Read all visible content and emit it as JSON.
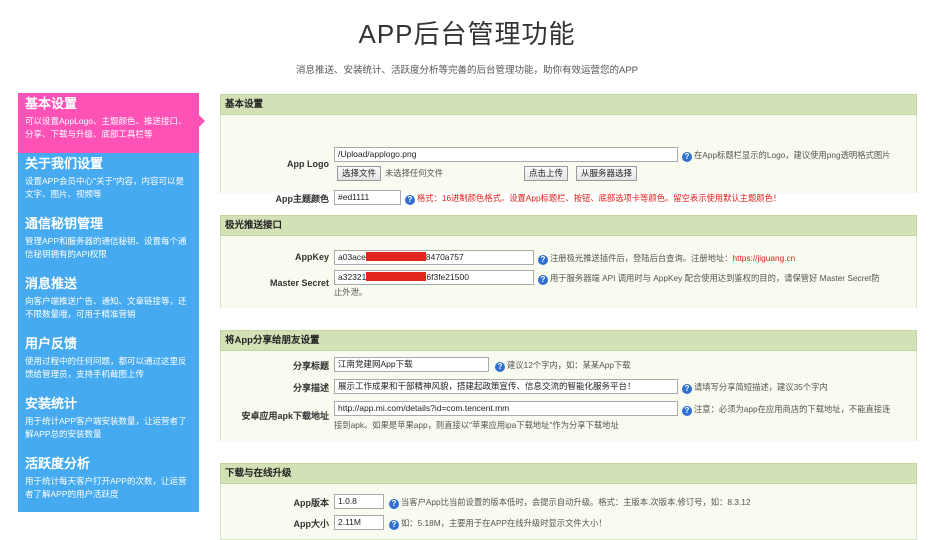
{
  "header": {
    "title": "APP后台管理功能",
    "subtitle": "消息推送、安装统计、活跃度分析等完善的后台管理功能，助你有效运营您的APP"
  },
  "sidebar": {
    "items": [
      {
        "title": "基本设置",
        "desc": "可以设置AppLogo、主题颜色、推送接口、分享、下载与升级、底部工具栏等",
        "active": true
      },
      {
        "title": "关于我们设置",
        "desc": "设置APP会员中心\"关于\"内容，内容可以是文字、图片、视频等"
      },
      {
        "title": "通信秘钥管理",
        "desc": "管理APP和服务器的通信秘钥、设置每个通信秘钥拥有的API权限"
      },
      {
        "title": "消息推送",
        "desc": "向客户端推送广告、通知、文章链接等，还不限数量哦，可用于精准营销"
      },
      {
        "title": "用户反馈",
        "desc": "使用过程中的任何问题，都可以通过这里反馈给管理员，支持手机截图上传"
      },
      {
        "title": "安装统计",
        "desc": "用于统计APP客户端安装数量，让运营者了解APP总的安装数量"
      },
      {
        "title": "活跃度分析",
        "desc": "用于统计每天客户打开APP的次数，让运营者了解APP的用户活跃度"
      }
    ]
  },
  "sections": {
    "basic": {
      "title": "基本设置",
      "logo_label": "App Logo",
      "logo_value": "/Upload/applogo.png",
      "choose_file": "选择文件",
      "no_file": "未选择任何文件",
      "upload": "点击上传",
      "from_server": "从服务器选择",
      "logo_hint": "在App标题栏显示的Logo，建议使用png透明格式图片",
      "color_label": "App主题颜色",
      "color_value": "#ed1111",
      "color_hint": "格式：16进制颜色格式。设置App标题栏、按钮、底部选项卡等颜色。留空表示使用默认主题颜色！"
    },
    "push": {
      "title": "极光推送接口",
      "appkey_label": "AppKey",
      "appkey_a": "a03ace",
      "appkey_b": "8470a757",
      "appkey_hint": "注册极光推送插件后，登陆后台查询。注册地址：",
      "appkey_link": "https://jiguang.cn",
      "secret_label": "Master Secret",
      "secret_a": "a32321",
      "secret_b": "6f3fe21500",
      "secret_hint1": "用于服务器端 API 调用时与 AppKey 配合使用达到鉴权的目的，请保管好 Master Secret防",
      "secret_hint2": "止外泄。"
    },
    "share": {
      "title": "将App分享给朋友设置",
      "title_label": "分享标题",
      "title_value": "江南党建网App下载",
      "title_hint": "建议12个字内，如：某某App下载",
      "desc_label": "分享描述",
      "desc_value": "展示工作成果和干部精神风貌，搭建起政策宣传、信息交流的智能化服务平台！",
      "desc_hint": "请填写分享简短描述，建议35个字内",
      "apk_label": "安卓应用apk下载地址",
      "apk_value": "http://app.mi.com/details?id=com.tencent.mm",
      "apk_hint1": "注意：必须为app在应用商店的下载地址，不能直接连",
      "apk_hint2": "接到apk。如果是苹果app，则直接以\"苹果应用ipa下载地址\"作为分享下载地址"
    },
    "upgrade": {
      "title": "下载与在线升级",
      "ver_label": "App版本",
      "ver_value": "1.0.8",
      "ver_hint": "当客户App比当前设置的版本低时，会提示自动升级。格式：主版本.次版本.修订号，如：8.3.12",
      "size_label": "App大小",
      "size_value": "2.11M",
      "size_hint": "如：5.18M，主要用于在APP在线升级时显示文件大小！"
    }
  },
  "colors": {
    "sidebar": "#45aaf0",
    "active": "#ff52b7",
    "section_head": "#d3e1b6",
    "accent_red": "#e0201a"
  }
}
